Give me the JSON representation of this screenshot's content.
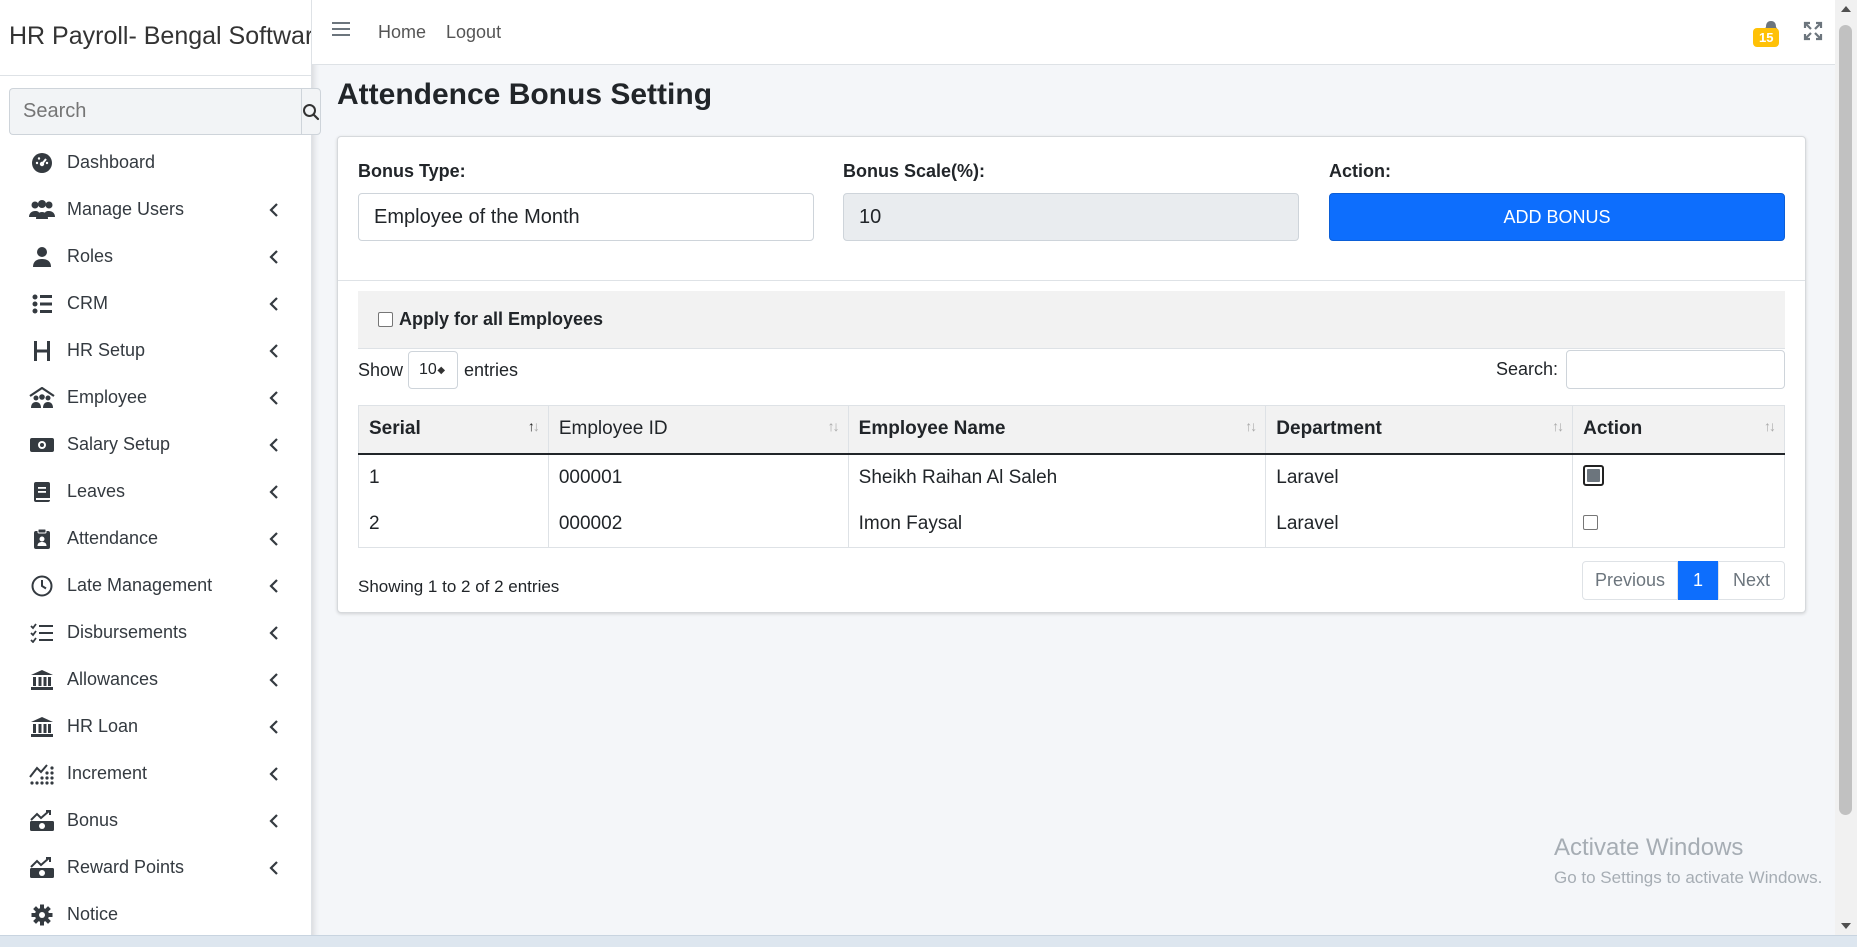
{
  "app": {
    "title": "HR Payroll- Bengal Software"
  },
  "sidebar": {
    "search_placeholder": "Search",
    "items": [
      {
        "label": "Dashboard",
        "icon": "dashboard-icon",
        "has_children": false
      },
      {
        "label": "Manage Users",
        "icon": "users-icon",
        "has_children": true
      },
      {
        "label": "Roles",
        "icon": "user-icon",
        "has_children": true
      },
      {
        "label": "CRM",
        "icon": "crm-icon",
        "has_children": true
      },
      {
        "label": "HR Setup",
        "icon": "h-icon",
        "has_children": true
      },
      {
        "label": "Employee",
        "icon": "employee-icon",
        "has_children": true
      },
      {
        "label": "Salary Setup",
        "icon": "money-icon",
        "has_children": true
      },
      {
        "label": "Leaves",
        "icon": "book-icon",
        "has_children": true
      },
      {
        "label": "Attendance",
        "icon": "clipboard-icon",
        "has_children": true
      },
      {
        "label": "Late Management",
        "icon": "clock-icon",
        "has_children": true
      },
      {
        "label": "Disbursements",
        "icon": "checklist-icon",
        "has_children": true
      },
      {
        "label": "Allowances",
        "icon": "bank-icon",
        "has_children": true
      },
      {
        "label": "HR Loan",
        "icon": "bank-icon",
        "has_children": true
      },
      {
        "label": "Increment",
        "icon": "increment-icon",
        "has_children": true
      },
      {
        "label": "Bonus",
        "icon": "chart-money-icon",
        "has_children": true
      },
      {
        "label": "Reward Points",
        "icon": "chart-money-icon",
        "has_children": true
      },
      {
        "label": "Notice",
        "icon": "gear-icon",
        "has_children": false
      }
    ]
  },
  "topbar": {
    "home": "Home",
    "logout": "Logout",
    "notification_count": "15"
  },
  "page": {
    "title": "Attendence Bonus Setting"
  },
  "form": {
    "bonus_type_label": "Bonus Type:",
    "bonus_type_value": "Employee of the Month",
    "bonus_scale_label": "Bonus Scale(%):",
    "bonus_scale_value": "10",
    "action_label": "Action:",
    "add_button": "ADD BONUS"
  },
  "apply_all": {
    "label": "Apply for all Employees",
    "checked": false
  },
  "datatable": {
    "show_label": "Show",
    "entries_label": "entries",
    "page_length": "10",
    "search_label": "Search:",
    "columns": [
      "Serial",
      "Employee ID",
      "Employee Name",
      "Department",
      "Action"
    ],
    "rows": [
      {
        "serial": "1",
        "employee_id": "000001",
        "name": "Sheikh Raihan Al Saleh",
        "department": "Laravel",
        "checked": true
      },
      {
        "serial": "2",
        "employee_id": "000002",
        "name": "Imon Faysal",
        "department": "Laravel",
        "checked": false
      }
    ],
    "info": "Showing 1 to 2 of 2 entries",
    "pagination": {
      "previous": "Previous",
      "current": "1",
      "next": "Next"
    }
  },
  "watermark": {
    "line1": "Activate Windows",
    "line2": "Go to Settings to activate Windows."
  },
  "colors": {
    "primary": "#0d6efd",
    "badge": "#ffc107",
    "sidebar_bg": "#ffffff",
    "content_bg": "#f4f6f9"
  }
}
